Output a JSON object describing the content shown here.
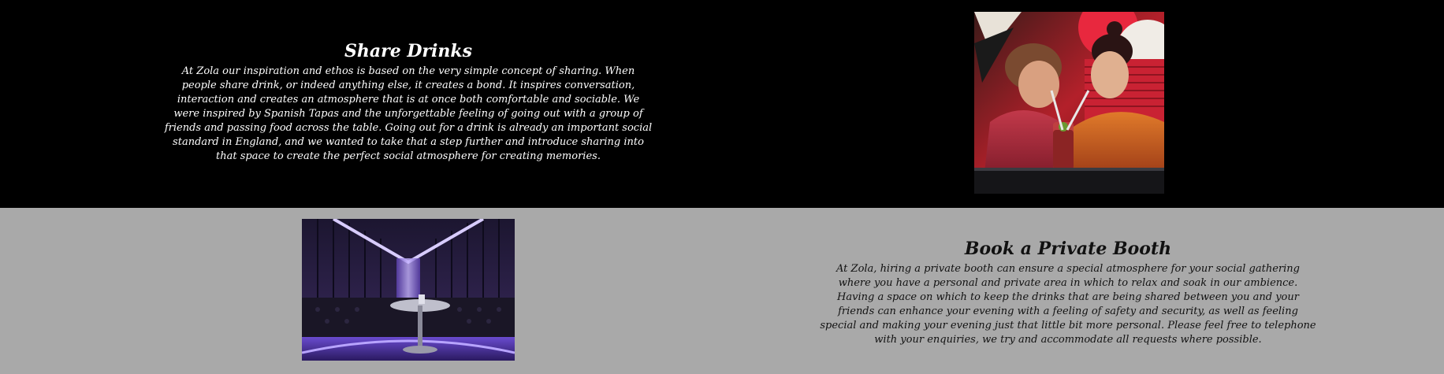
{
  "share_section": {
    "title": "Share Drinks",
    "body": "At Zola our inspiration and ethos is based on the very simple concept of sharing. When people share drink, or indeed anything else, it creates a bond. It inspires conversation, interaction and creates an atmosphere that is at once both comfortable and sociable. We were inspired by Spanish Tapas and the unforgettable feeling of going out with a group of friends and passing food across the table. Going out for a drink is already an important social standard in England, and we wanted to take that a step further and introduce sharing into that space to create the perfect social atmosphere for creating memories.",
    "background_color": "#000000",
    "text_color": "#ffffff"
  },
  "booth_section": {
    "title": "Book a Private Booth",
    "body": "At Zola, hiring a private booth can ensure a special atmosphere for your social gathering where you have a personal and private area in which to relax and soak in our ambience. Having a space on which to keep the drinks that are being shared between you and your friends can enhance your evening with a feeling of safety and security, as well as feeling special and making your evening just that little bit more personal. Please feel free to telephone with your enquiries, we try and accommodate all requests where possible.",
    "background_color": "#a9a9a9",
    "text_color": "#111111"
  },
  "images": {
    "share_photo_icon": "photo-two-people-sharing-drink",
    "booth_photo_icon": "photo-purple-lit-private-booth"
  }
}
